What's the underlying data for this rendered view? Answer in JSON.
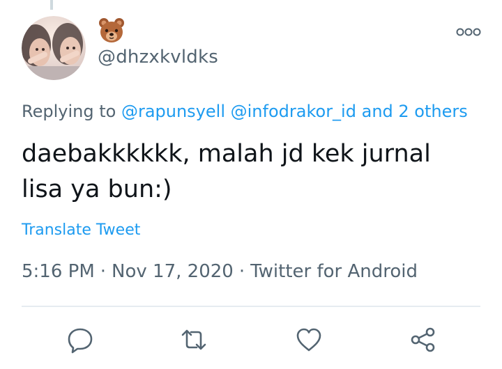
{
  "author": {
    "handle": "@dhzxkvldks",
    "display_name_icon": "bear-face-emoji-icon",
    "avatar": "profile-photo"
  },
  "reply_context": {
    "prefix": "Replying to",
    "mention_1": "@rapunsyell",
    "mention_2": "@infodrakor_id",
    "others": "and 2 others"
  },
  "tweet": {
    "text": "daebakkkkkk, malah jd kek jurnal lisa ya bun:)",
    "translate_label": "Translate Tweet"
  },
  "meta": {
    "time": "5:16 PM",
    "separator": "·",
    "date": "Nov 17, 2020",
    "source": "Twitter for Android"
  },
  "actions": [
    "reply-icon",
    "retweet-icon",
    "like-icon",
    "share-icon"
  ],
  "colors": {
    "link": "#1d9bf0",
    "secondary_text": "#536471",
    "primary_text": "#0f1419",
    "divider": "#e6ecf0"
  }
}
